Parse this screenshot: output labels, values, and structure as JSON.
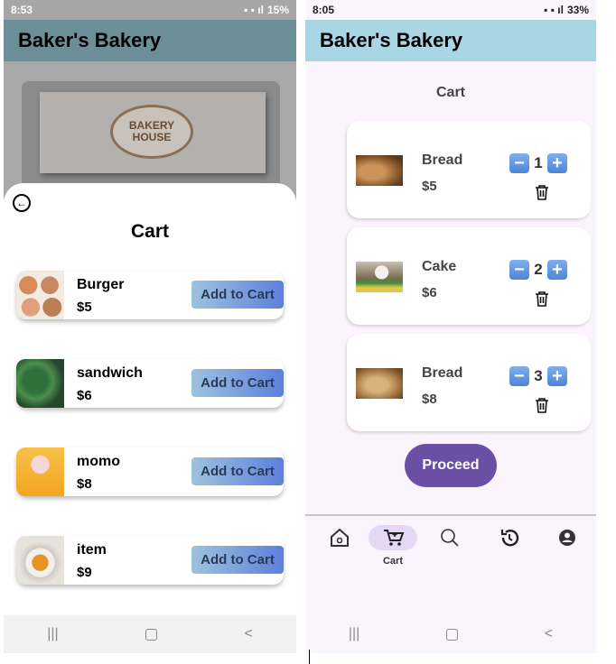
{
  "left": {
    "status": {
      "time": "8:53",
      "battery": "15%"
    },
    "app_title": "Baker's Bakery",
    "banner": {
      "line1": "BAKERY",
      "line2": "HOUSE"
    },
    "sheet": {
      "title": "Cart",
      "items": [
        {
          "name": "Burger",
          "price": "$5",
          "button": "Add to Cart"
        },
        {
          "name": "sandwich",
          "price": "$6",
          "button": "Add to Cart"
        },
        {
          "name": "momo",
          "price": "$8",
          "button": "Add to Cart"
        },
        {
          "name": "item",
          "price": "$9",
          "button": "Add to Cart"
        }
      ]
    }
  },
  "right": {
    "status": {
      "time": "8:05",
      "battery": "33%"
    },
    "app_title": "Baker's Bakery",
    "cart_title": "Cart",
    "items": [
      {
        "name": "Bread",
        "price": "$5",
        "qty": "1"
      },
      {
        "name": "Cake",
        "price": "$6",
        "qty": "2"
      },
      {
        "name": "Bread",
        "price": "$8",
        "qty": "3"
      }
    ],
    "proceed_label": "Proceed",
    "nav": {
      "active_label": "Cart"
    }
  },
  "colors": {
    "left_appbar": "#6c8f97",
    "right_appbar": "#a9d6e5",
    "add_button_start": "#9dc3dd",
    "add_button_end": "#5d7fdd",
    "proceed": "#6b4fa4",
    "qty_button": "#4c84d8",
    "nav_active_pill": "#e6d8f5"
  },
  "icons": [
    "back-arrow-icon",
    "plus-icon",
    "minus-icon",
    "trash-icon",
    "home-icon",
    "cart-icon",
    "search-icon",
    "history-icon",
    "profile-icon"
  ]
}
